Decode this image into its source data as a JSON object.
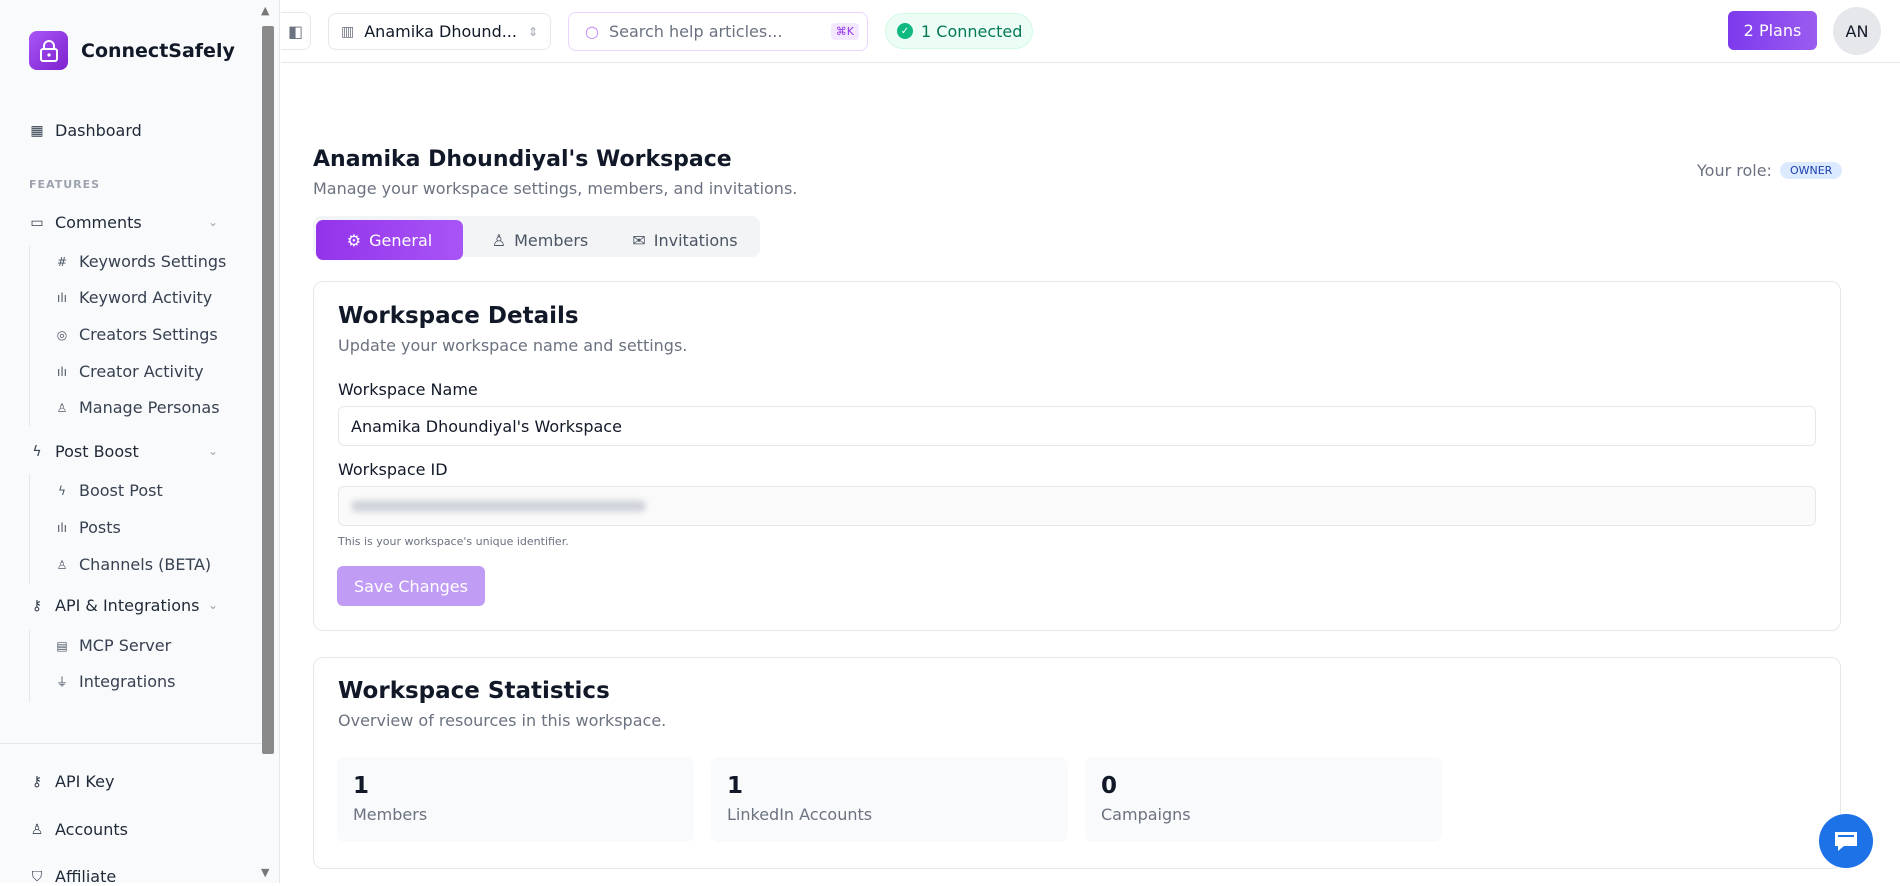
{
  "brand": {
    "name": "ConnectSafely"
  },
  "sidebar": {
    "dashboard": "Dashboard",
    "section": "FEATURES",
    "groups": [
      {
        "label": "Comments",
        "items": [
          "Keywords Settings",
          "Keyword Activity",
          "Creators Settings",
          "Creator Activity",
          "Manage Personas"
        ]
      },
      {
        "label": "Post Boost",
        "items": [
          "Boost Post",
          "Posts",
          "Channels (BETA)"
        ]
      },
      {
        "label": "API & Integrations",
        "items": [
          "MCP Server",
          "Integrations"
        ]
      }
    ],
    "bottom": [
      "API Key",
      "Accounts",
      "Affiliate"
    ]
  },
  "topbar": {
    "workspace": "Anamika Dhound...",
    "search_placeholder": "Search help articles...",
    "shortcut": "⌘K",
    "connected": "1 Connected",
    "plans": "2 Plans",
    "avatar": "AN"
  },
  "page": {
    "title": "Anamika Dhoundiyal's Workspace",
    "subtitle": "Manage your workspace settings, members, and invitations.",
    "role_label": "Your role:",
    "role": "OWNER",
    "tabs": [
      "General",
      "Members",
      "Invitations"
    ],
    "active_tab": "General"
  },
  "details": {
    "title": "Workspace Details",
    "subtitle": "Update your workspace name and settings.",
    "name_label": "Workspace Name",
    "name_value": "Anamika Dhoundiyal's Workspace",
    "id_label": "Workspace ID",
    "id_hint": "This is your workspace's unique identifier.",
    "save": "Save Changes"
  },
  "stats": {
    "title": "Workspace Statistics",
    "subtitle": "Overview of resources in this workspace.",
    "items": [
      {
        "value": "1",
        "label": "Members"
      },
      {
        "value": "1",
        "label": "LinkedIn Accounts"
      },
      {
        "value": "0",
        "label": "Campaigns"
      }
    ]
  },
  "colors": {
    "accent": "#9333ea",
    "connected_bg": "#ecfdf5",
    "connected_text": "#047857",
    "role_bg": "#dbeafe",
    "chat": "#1d72e8"
  }
}
